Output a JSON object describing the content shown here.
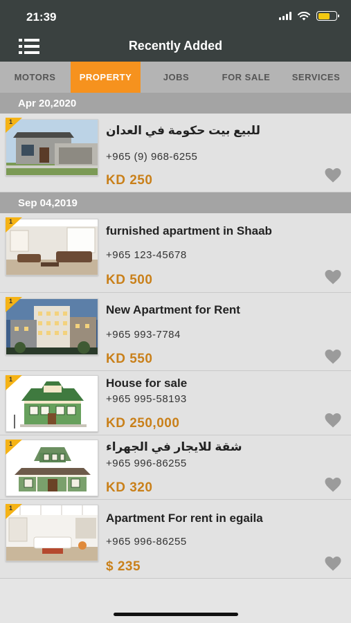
{
  "status": {
    "time": "21:39",
    "battery_color": "#f2c811"
  },
  "header": {
    "title": "Recently Added",
    "menu_icon": "hamburger-menu-icon"
  },
  "tabs": [
    {
      "label": "MOTORS",
      "active": false
    },
    {
      "label": "PROPERTY",
      "active": true
    },
    {
      "label": "JOBS",
      "active": false
    },
    {
      "label": "FOR SALE",
      "active": false
    },
    {
      "label": "SERVICES",
      "active": false
    }
  ],
  "colors": {
    "header": "#3a4140",
    "accent": "#f6921e",
    "price": "#c9801a",
    "badge": "#f5b316"
  },
  "groups": [
    {
      "date": "Apr 20,2020",
      "listings": [
        {
          "badge": "1",
          "title": "للبيع بيت حكومة في العدان",
          "phone": "+965 (9) 968-6255",
          "price": "KD 250",
          "image": "house-exterior"
        }
      ]
    },
    {
      "date": "Sep 04,2019",
      "listings": [
        {
          "badge": "1",
          "title": "furnished apartment in Shaab",
          "phone": "+965 123-45678",
          "price": "KD 500",
          "image": "living-room"
        },
        {
          "badge": "1",
          "title": "New Apartment for Rent",
          "phone": "+965 993-7784",
          "price": "KD 550",
          "image": "apartment-building"
        },
        {
          "badge": "1",
          "title": "House for sale",
          "phone": "+965 995-58193",
          "price": "KD 250,000",
          "image": "green-house"
        },
        {
          "badge": "1",
          "title": "شقة للايجار في الجهراء",
          "phone": "+965 996-86255",
          "price": "KD 320",
          "image": "cottage"
        },
        {
          "badge": "1",
          "title": "Apartment For rent in egaila",
          "phone": "+965 996-86255",
          "price": "$ 235",
          "image": "loft"
        }
      ]
    }
  ]
}
